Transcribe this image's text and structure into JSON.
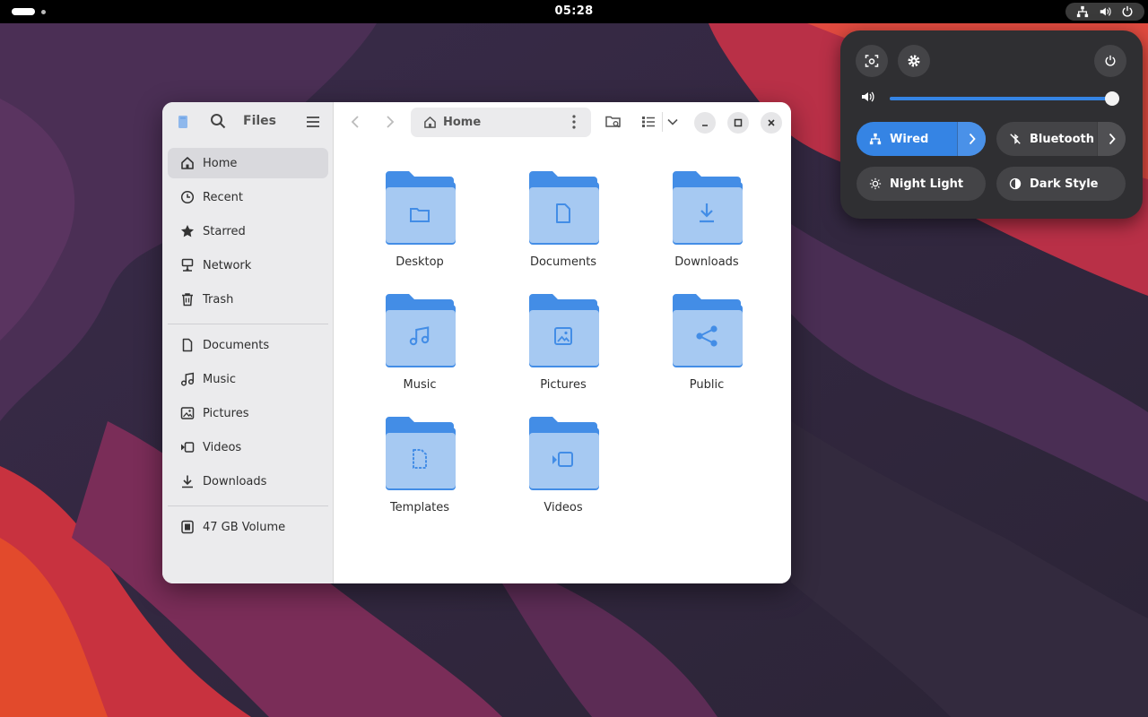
{
  "topbar": {
    "clock": "05:28"
  },
  "files_window": {
    "sidebar_title": "Files",
    "sidebar_places": [
      {
        "label": "Home",
        "icon": "home-icon"
      },
      {
        "label": "Recent",
        "icon": "clock-icon"
      },
      {
        "label": "Starred",
        "icon": "star-icon"
      },
      {
        "label": "Network",
        "icon": "network-icon"
      },
      {
        "label": "Trash",
        "icon": "trash-icon"
      }
    ],
    "sidebar_bookmarks": [
      {
        "label": "Documents",
        "icon": "document-icon"
      },
      {
        "label": "Music",
        "icon": "music-icon"
      },
      {
        "label": "Pictures",
        "icon": "picture-icon"
      },
      {
        "label": "Videos",
        "icon": "video-icon"
      },
      {
        "label": "Downloads",
        "icon": "download-icon"
      }
    ],
    "sidebar_devices": [
      {
        "label": "47 GB Volume",
        "icon": "drive-icon"
      }
    ],
    "active_item": "Home",
    "path": "Home",
    "folders": [
      {
        "label": "Desktop",
        "icon": "folder-glyph-icon"
      },
      {
        "label": "Documents",
        "icon": "document-glyph-icon"
      },
      {
        "label": "Downloads",
        "icon": "download-glyph-icon"
      },
      {
        "label": "Music",
        "icon": "music-glyph-icon"
      },
      {
        "label": "Pictures",
        "icon": "picture-glyph-icon"
      },
      {
        "label": "Public",
        "icon": "share-glyph-icon"
      },
      {
        "label": "Templates",
        "icon": "template-glyph-icon"
      },
      {
        "label": "Videos",
        "icon": "video-glyph-icon"
      }
    ]
  },
  "quick_settings": {
    "volume_level": 0.97,
    "toggles": [
      {
        "label": "Wired",
        "state": "on",
        "has_arrow": true,
        "icon": "wired-network-icon"
      },
      {
        "label": "Bluetooth",
        "state": "off",
        "has_arrow": true,
        "icon": "bluetooth-disabled-icon"
      },
      {
        "label": "Night Light",
        "state": "off",
        "has_arrow": false,
        "icon": "night-light-icon"
      },
      {
        "label": "Dark Style",
        "state": "off",
        "has_arrow": false,
        "icon": "dark-style-icon"
      }
    ]
  },
  "colors": {
    "accent": "#3584e4",
    "folder_light": "#a6c9f2",
    "folder_dark": "#438de6",
    "sidebar_bg": "#ebebed",
    "panel_bg": "#2f2f32"
  }
}
